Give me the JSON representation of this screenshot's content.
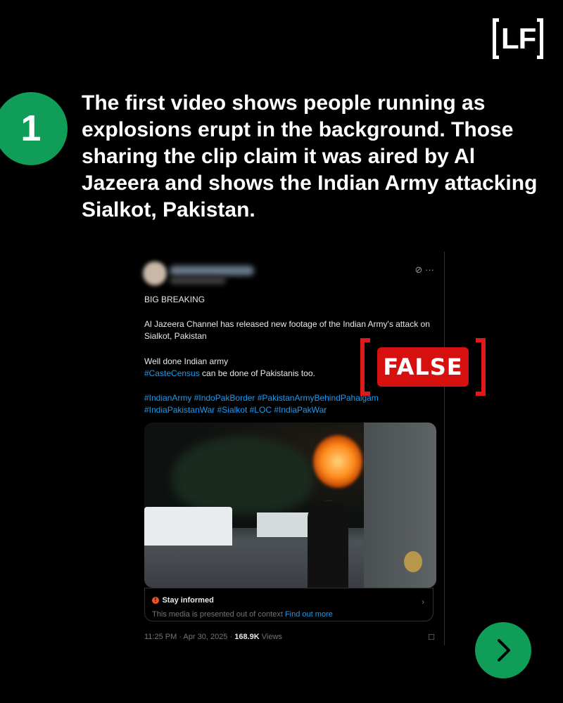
{
  "brand": {
    "logo_text": "LF"
  },
  "slide": {
    "number": "1",
    "headline": "The first video shows people running as explosions erupt in the background. Those sharing the clip claim it was aired by Al Jazeera and shows the Indian Army attacking Sialkot, Pakistan."
  },
  "tweet": {
    "icons": [
      "grok-icon",
      "more-icon"
    ],
    "line1": "BIG BREAKING",
    "line2": "Al Jazeera Channel has released new footage of the Indian Army's attack on Sialkot, Pakistan",
    "line3": "Well done Indian army",
    "hashtag_lead": "#CasteCensus",
    "line4_rest": " can be done of Pakistanis too.",
    "hashtags_line1": "#IndianArmy #IndoPakBorder #PakistanArmyBehindPahalgam",
    "hashtags_line2": "#IndiaPakistanWar #Sialkot #LOC #IndiaPakWar",
    "notice_title": "Stay informed",
    "notice_text": "This media is presented out of context",
    "notice_link": "Find out more",
    "time": "11:25 PM · Apr 30, 2025 · ",
    "views_count": "168.9K",
    "views_label": " Views"
  },
  "verdict": {
    "label": "FALSE",
    "color": "#d60f0f"
  },
  "colors": {
    "accent_green": "#0f9d58",
    "link_blue": "#1d9bf0"
  }
}
